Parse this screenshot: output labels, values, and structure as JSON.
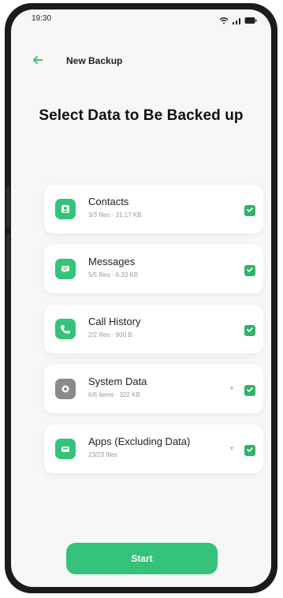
{
  "statusbar": {
    "time": "19:30"
  },
  "appbar": {
    "title": "New Backup"
  },
  "page": {
    "title": "Select Data to Be Backed up"
  },
  "items": [
    {
      "name": "Contacts",
      "meta": "3/3 files · 31.17 KB",
      "icon": "contact-icon",
      "color": "#35c27a",
      "checked": true,
      "expandable": false
    },
    {
      "name": "Messages",
      "meta": "5/5 files · 6.33 KB",
      "icon": "message-icon",
      "color": "#35c27a",
      "checked": true,
      "expandable": false
    },
    {
      "name": "Call History",
      "meta": "2/2 files · 900 B",
      "icon": "phone-icon",
      "color": "#35c27a",
      "checked": true,
      "expandable": false
    },
    {
      "name": "System Data",
      "meta": "6/6 items · 322 KB",
      "icon": "settings-icon",
      "color": "#8b8b8b",
      "checked": true,
      "expandable": true
    },
    {
      "name": "Apps (Excluding Data)",
      "meta": "23/23 files",
      "icon": "apps-icon",
      "color": "#35c27a",
      "checked": true,
      "expandable": true
    }
  ],
  "actions": {
    "start_label": "Start"
  },
  "colors": {
    "accent": "#35c27a",
    "check": "#2fb36a",
    "phone_frame": "#1b1b1b"
  }
}
